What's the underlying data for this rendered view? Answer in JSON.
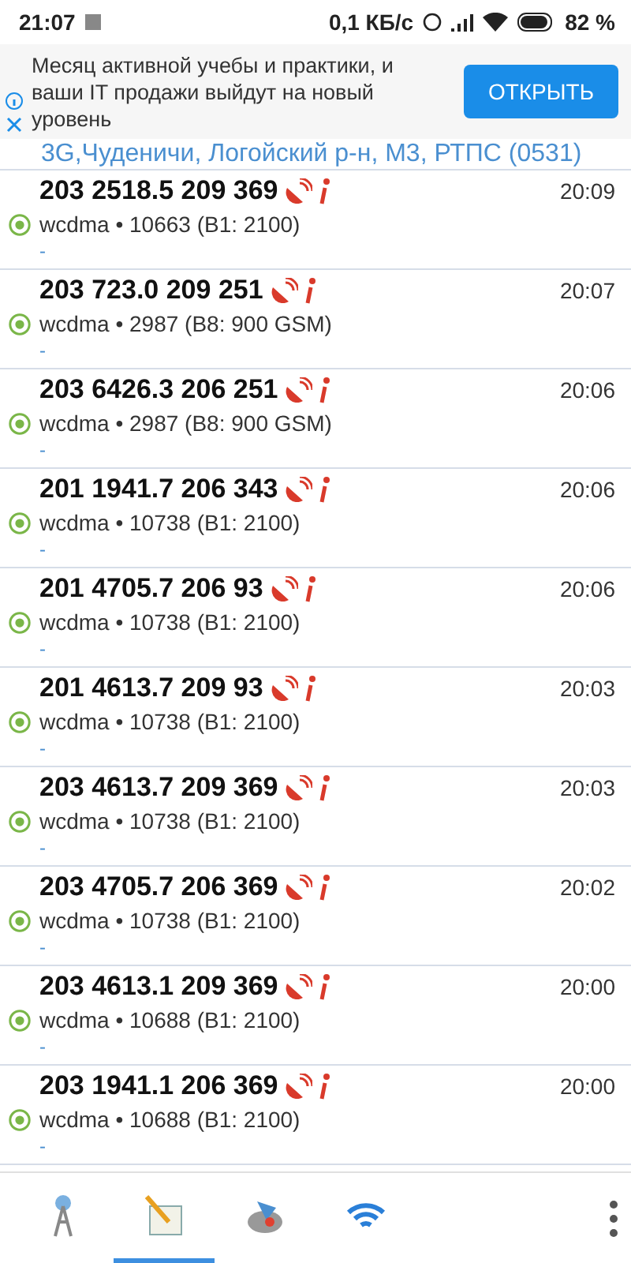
{
  "status_bar": {
    "time": "21:07",
    "speed": "0,1 КБ/с",
    "battery": "82 %"
  },
  "ad": {
    "text": "Месяц активной учебы и практики, и ваши IT продажи выйдут на новый уровень",
    "button": "ОТКРЫТЬ"
  },
  "header_partial": "3G,Чуденичи, Логойский р-н, М3, РТПС (0531)",
  "rows": [
    {
      "title": "203 2518.5 209 369",
      "time": "20:09",
      "subtitle": "wcdma • 10663 (B1: 2100)",
      "note": "-"
    },
    {
      "title": "203 723.0 209 251",
      "time": "20:07",
      "subtitle": "wcdma • 2987 (B8: 900 GSM)",
      "note": "-"
    },
    {
      "title": "203 6426.3 206 251",
      "time": "20:06",
      "subtitle": "wcdma • 2987 (B8: 900 GSM)",
      "note": "-"
    },
    {
      "title": "201 1941.7 206 343",
      "time": "20:06",
      "subtitle": "wcdma • 10738 (B1: 2100)",
      "note": "-"
    },
    {
      "title": "201 4705.7 206 93",
      "time": "20:06",
      "subtitle": "wcdma • 10738 (B1: 2100)",
      "note": "-"
    },
    {
      "title": "201 4613.7 209 93",
      "time": "20:03",
      "subtitle": "wcdma • 10738 (B1: 2100)",
      "note": "-"
    },
    {
      "title": "203 4613.7 209 369",
      "time": "20:03",
      "subtitle": "wcdma • 10738 (B1: 2100)",
      "note": "-"
    },
    {
      "title": "203 4705.7 206 369",
      "time": "20:02",
      "subtitle": "wcdma • 10738 (B1: 2100)",
      "note": "-"
    },
    {
      "title": "203 4613.1 209 369",
      "time": "20:00",
      "subtitle": "wcdma • 10688 (B1: 2100)",
      "note": "-"
    },
    {
      "title": "203 1941.1 206 369",
      "time": "20:00",
      "subtitle": "wcdma • 10688 (B1: 2100)",
      "note": "-"
    }
  ],
  "nav": [
    {
      "kind": "tower",
      "selected": false
    },
    {
      "kind": "notepad",
      "selected": true
    },
    {
      "kind": "compass",
      "selected": false
    },
    {
      "kind": "wifi",
      "selected": false
    }
  ]
}
